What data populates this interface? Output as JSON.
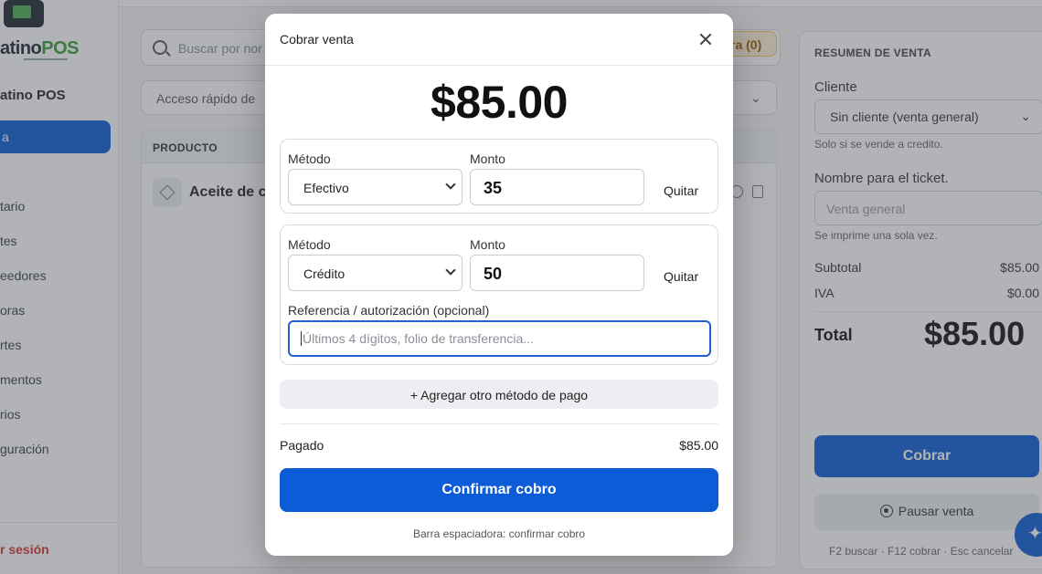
{
  "sidebar": {
    "logo_text": "atino",
    "logo_pos": "POS",
    "brand": "atino POS",
    "active_item": "a",
    "items": [
      "tario",
      "tes",
      "eedores",
      "oras",
      "rtes",
      "mentos",
      "rios",
      "guración"
    ],
    "logout": "r sesión"
  },
  "main": {
    "search_placeholder": "Buscar por nor",
    "badge": "ra (0)",
    "quick_access": "Acceso rápido de",
    "quick_chevron": "⌄",
    "table_header": "PRODUCTO",
    "product_name": "Aceite de c"
  },
  "summary": {
    "title": "RESUMEN DE VENTA",
    "client_label": "Cliente",
    "client_value": "Sin cliente (venta general)",
    "client_chevron": "⌄",
    "client_hint": "Solo si se vende a credito.",
    "ticket_label": "Nombre para el ticket.",
    "ticket_placeholder": "Venta general",
    "ticket_hint": "Se imprime una sola vez.",
    "subtotal_label": "Subtotal",
    "subtotal_value": "$85.00",
    "iva_label": "IVA",
    "iva_value": "$0.00",
    "total_label": "Total",
    "total_value": "$85.00",
    "cobrar": "Cobrar",
    "pausar": "Pausar venta",
    "shortcuts": "F2 buscar · F12 cobrar · Esc cancelar"
  },
  "modal": {
    "title": "Cobrar venta",
    "amount": "$85.00",
    "payments": [
      {
        "method_label": "Método",
        "method": "Efectivo",
        "amount_label": "Monto",
        "amount": "35",
        "remove": "Quitar"
      },
      {
        "method_label": "Método",
        "method": "Crédito",
        "amount_label": "Monto",
        "amount": "50",
        "remove": "Quitar",
        "reference_label": "Referencia / autorización (opcional)",
        "reference_placeholder": "Últimos 4 dígitos, folio de transferencia..."
      }
    ],
    "add_method": "+ Agregar otro método de pago",
    "paid_label": "Pagado",
    "paid_value": "$85.00",
    "confirm": "Confirmar cobro",
    "hint": "Barra espaciadora: confirmar cobro"
  },
  "colors": {
    "primary": "#0b5cd6",
    "danger": "#d8322c",
    "focus_border": "#1f5fd0"
  }
}
